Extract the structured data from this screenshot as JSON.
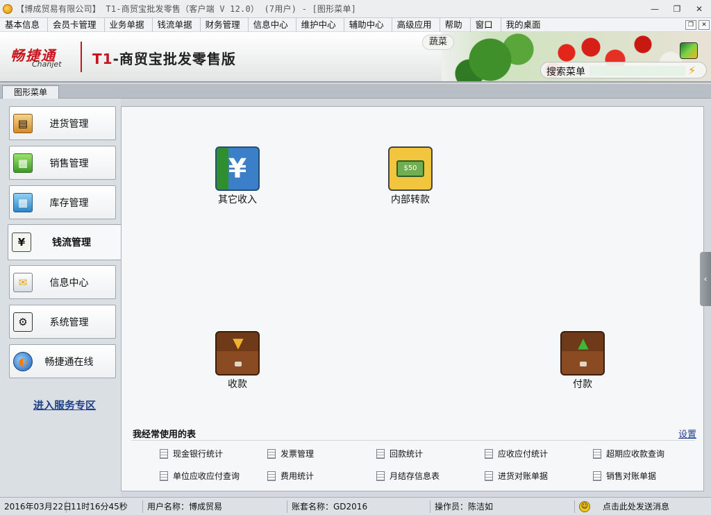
{
  "window": {
    "title": "【博成贸易有限公司】 T1-商贸宝批发零售（客户端 V 12.0） (7用户) - [图形菜单]",
    "minimize": "—",
    "restore": "❐",
    "close": "✕"
  },
  "menubar": {
    "items": [
      "基本信息",
      "会员卡管理",
      "业务单据",
      "钱流单据",
      "财务管理",
      "信息中心",
      "维护中心",
      "辅助中心",
      "高级应用",
      "帮助",
      "窗口",
      "我的桌面"
    ]
  },
  "mdi": {
    "restore": "❐",
    "close": "✕"
  },
  "header": {
    "logo_cn": "畅捷通",
    "logo_en": "Chanjet",
    "product_prefix": "T1",
    "product_title": "-商贸宝批发零售版",
    "veg_label": "蔬菜",
    "search_label": "搜索菜单",
    "search_value": "",
    "search_icon": "lightning-icon"
  },
  "tabs": [
    {
      "label": "图形菜单"
    }
  ],
  "sidebar": {
    "items": [
      {
        "label": "进货管理",
        "icon": "purchase-icon"
      },
      {
        "label": "销售管理",
        "icon": "basket-icon"
      },
      {
        "label": "库存管理",
        "icon": "inventory-icon"
      },
      {
        "label": "钱流管理",
        "icon": "cashflow-icon",
        "active": true
      },
      {
        "label": "信息中心",
        "icon": "info-icon"
      },
      {
        "label": "系统管理",
        "icon": "settings-icon"
      },
      {
        "label": "畅捷通在线",
        "icon": "globe-icon"
      }
    ],
    "service_link": "进入服务专区"
  },
  "main": {
    "tiles": [
      {
        "label": "其它收入",
        "icon": "yuan-icon"
      },
      {
        "label": "内部转款",
        "icon": "transfer-icon"
      },
      {
        "label": "收款",
        "icon": "drawer-in-icon"
      },
      {
        "label": "付款",
        "icon": "drawer-out-icon"
      }
    ],
    "frequent_title": "我经常使用的表",
    "frequent_setting": "设置",
    "frequent_items": [
      "现金银行统计",
      "发票管理",
      "回款统计",
      "应收应付统计",
      "超期应收款查询",
      "单位应收应付查询",
      "费用统计",
      "月结存信息表",
      "进货对账单据",
      "销售对账单据"
    ]
  },
  "statusbar": {
    "date": "2016年03月22日",
    "time": "11时16分45秒",
    "user": "用户名称：博成贸易",
    "account": "账套名称：GD2016",
    "operator": "操作员：陈洁如",
    "message": "点击此处发送消息"
  },
  "colors": {
    "brand_red": "#c8141c",
    "link_blue": "#1f3f8a",
    "panel_bg": "#dadfe3",
    "content_bg": "#f6f7f9"
  }
}
